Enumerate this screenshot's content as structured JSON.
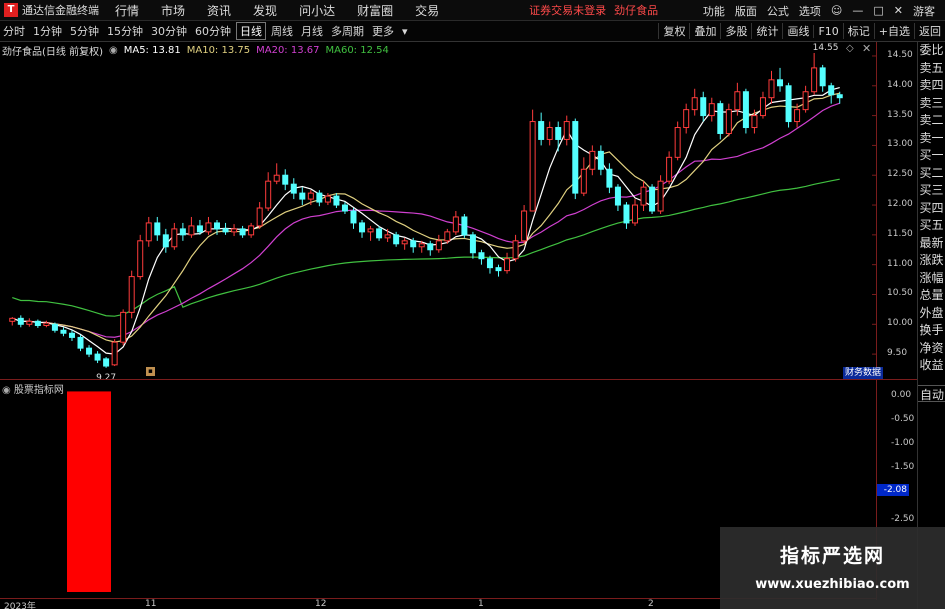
{
  "app": {
    "title": "通达信金融终端",
    "logo": "T"
  },
  "menu": [
    "行情",
    "市场",
    "资讯",
    "发现",
    "问小达",
    "财富圈",
    "交易"
  ],
  "notice": {
    "login": "证券交易未登录",
    "stock": "劲仔食品"
  },
  "top_right": [
    "功能",
    "版面",
    "公式",
    "选项"
  ],
  "guest": "游客",
  "periods": [
    "分时",
    "1分钟",
    "5分钟",
    "15分钟",
    "30分钟",
    "60分钟",
    "日线",
    "周线",
    "月线",
    "多周期",
    "更多"
  ],
  "active_period": "日线",
  "toolbar_right": [
    "复权",
    "叠加",
    "多股",
    "统计",
    "画线",
    "F10",
    "标记",
    "+自选",
    "返回"
  ],
  "legend": {
    "title": "劲仔食品(日线 前复权)",
    "ma5": "MA5: 13.81",
    "ma10": "MA10: 13.75",
    "ma20": "MA20: 13.67",
    "ma60": "MA60: 12.54"
  },
  "annotations": {
    "high": "14.55",
    "low": "9.27"
  },
  "side_panel": [
    "委比",
    "卖五",
    "卖四",
    "卖三",
    "卖二",
    "卖一",
    "买一",
    "买二",
    "买三",
    "买四",
    "买五",
    "最新",
    "涨跌",
    "涨幅",
    "总量",
    "外盘",
    "换手",
    "净资",
    "收益"
  ],
  "side_auto": "自动",
  "cw_flag": "财务数据",
  "subchart": {
    "title": "股票指标网",
    "current_value": "-2.08",
    "ticks": [
      "0.00",
      "-0.50",
      "-1.00",
      "-1.50",
      "-2.00",
      "-2.50"
    ]
  },
  "xaxis": [
    "2023年",
    "11",
    "12",
    "1",
    "2"
  ],
  "watermark": {
    "line1": "指标严选网",
    "line2": "www.xuezhibiao.com"
  },
  "chart_data": [
    {
      "type": "candlestick",
      "title": "劲仔食品(日线 前复权)",
      "ylim": [
        9.2,
        14.6
      ],
      "yticks": [
        9.5,
        10.0,
        10.5,
        11.0,
        11.5,
        12.0,
        12.5,
        13.0,
        13.5,
        14.0,
        14.5
      ],
      "colors": {
        "up": "#ff3c3c",
        "down": "#54ffff",
        "ma5": "#ffffff",
        "ma10": "#e0d080",
        "ma20": "#d040d0",
        "ma60": "#40c040"
      },
      "candles": [
        [
          10.05,
          10.1,
          9.98,
          10.12
        ],
        [
          10.1,
          10.0,
          9.95,
          10.15
        ],
        [
          10.0,
          10.05,
          9.96,
          10.1
        ],
        [
          10.05,
          9.98,
          9.94,
          10.08
        ],
        [
          9.98,
          10.02,
          9.95,
          10.06
        ],
        [
          10.0,
          9.9,
          9.86,
          10.03
        ],
        [
          9.9,
          9.85,
          9.8,
          9.95
        ],
        [
          9.85,
          9.78,
          9.72,
          9.9
        ],
        [
          9.78,
          9.6,
          9.55,
          9.82
        ],
        [
          9.6,
          9.5,
          9.45,
          9.65
        ],
        [
          9.5,
          9.4,
          9.35,
          9.55
        ],
        [
          9.42,
          9.3,
          9.27,
          9.45
        ],
        [
          9.32,
          9.7,
          9.3,
          9.75
        ],
        [
          9.7,
          10.2,
          9.65,
          10.25
        ],
        [
          10.2,
          10.8,
          10.1,
          10.9
        ],
        [
          10.8,
          11.4,
          10.75,
          11.5
        ],
        [
          11.4,
          11.7,
          11.3,
          11.8
        ],
        [
          11.7,
          11.5,
          11.4,
          11.8
        ],
        [
          11.5,
          11.3,
          11.2,
          11.6
        ],
        [
          11.3,
          11.6,
          11.25,
          11.7
        ],
        [
          11.6,
          11.5,
          11.4,
          11.7
        ],
        [
          11.5,
          11.65,
          11.45,
          11.8
        ],
        [
          11.65,
          11.55,
          11.5,
          11.75
        ],
        [
          11.55,
          11.7,
          11.5,
          11.8
        ],
        [
          11.7,
          11.6,
          11.5,
          11.75
        ],
        [
          11.6,
          11.55,
          11.5,
          11.7
        ],
        [
          11.55,
          11.6,
          11.48,
          11.68
        ],
        [
          11.6,
          11.5,
          11.45,
          11.65
        ],
        [
          11.5,
          11.65,
          11.45,
          11.7
        ],
        [
          11.65,
          11.95,
          11.6,
          12.05
        ],
        [
          11.95,
          12.4,
          11.9,
          12.55
        ],
        [
          12.4,
          12.5,
          12.35,
          12.7
        ],
        [
          12.5,
          12.35,
          12.25,
          12.6
        ],
        [
          12.35,
          12.2,
          12.1,
          12.45
        ],
        [
          12.2,
          12.1,
          12.0,
          12.3
        ],
        [
          12.1,
          12.2,
          12.0,
          12.25
        ],
        [
          12.2,
          12.05,
          11.98,
          12.25
        ],
        [
          12.05,
          12.15,
          12.0,
          12.2
        ],
        [
          12.15,
          12.0,
          11.95,
          12.2
        ],
        [
          12.0,
          11.9,
          11.85,
          12.05
        ],
        [
          11.9,
          11.7,
          11.6,
          11.95
        ],
        [
          11.7,
          11.55,
          11.45,
          11.75
        ],
        [
          11.55,
          11.6,
          11.4,
          11.65
        ],
        [
          11.6,
          11.45,
          11.4,
          11.65
        ],
        [
          11.45,
          11.5,
          11.38,
          11.6
        ],
        [
          11.5,
          11.35,
          11.3,
          11.55
        ],
        [
          11.35,
          11.4,
          11.25,
          11.45
        ],
        [
          11.4,
          11.3,
          11.2,
          11.45
        ],
        [
          11.3,
          11.35,
          11.2,
          11.4
        ],
        [
          11.35,
          11.25,
          11.15,
          11.4
        ],
        [
          11.25,
          11.4,
          11.2,
          11.5
        ],
        [
          11.4,
          11.55,
          11.35,
          11.6
        ],
        [
          11.55,
          11.8,
          11.5,
          11.9
        ],
        [
          11.8,
          11.5,
          11.45,
          11.85
        ],
        [
          11.5,
          11.2,
          11.1,
          11.55
        ],
        [
          11.2,
          11.1,
          11.0,
          11.25
        ],
        [
          11.1,
          10.95,
          10.85,
          11.15
        ],
        [
          10.95,
          10.9,
          10.8,
          11.0
        ],
        [
          10.9,
          11.1,
          10.85,
          11.2
        ],
        [
          11.1,
          11.4,
          11.05,
          11.5
        ],
        [
          11.4,
          11.9,
          11.35,
          12.0
        ],
        [
          11.9,
          13.4,
          11.9,
          13.6
        ],
        [
          13.4,
          13.1,
          13.0,
          13.55
        ],
        [
          13.1,
          13.3,
          13.0,
          13.4
        ],
        [
          13.3,
          13.1,
          12.9,
          13.4
        ],
        [
          13.1,
          13.4,
          13.0,
          13.5
        ],
        [
          13.4,
          12.2,
          12.1,
          13.45
        ],
        [
          12.2,
          12.6,
          12.15,
          12.8
        ],
        [
          12.6,
          12.9,
          12.5,
          13.0
        ],
        [
          12.9,
          12.6,
          12.5,
          13.0
        ],
        [
          12.6,
          12.3,
          12.2,
          12.7
        ],
        [
          12.3,
          12.0,
          11.9,
          12.35
        ],
        [
          12.0,
          11.7,
          11.6,
          12.05
        ],
        [
          11.7,
          12.0,
          11.65,
          12.1
        ],
        [
          12.0,
          12.3,
          11.9,
          12.4
        ],
        [
          12.3,
          11.9,
          11.85,
          12.35
        ],
        [
          11.9,
          12.4,
          11.85,
          12.5
        ],
        [
          12.4,
          12.8,
          12.35,
          12.9
        ],
        [
          12.8,
          13.3,
          12.75,
          13.4
        ],
        [
          13.3,
          13.6,
          13.2,
          13.7
        ],
        [
          13.6,
          13.8,
          13.5,
          13.95
        ],
        [
          13.8,
          13.5,
          13.4,
          13.9
        ],
        [
          13.5,
          13.7,
          13.4,
          13.8
        ],
        [
          13.7,
          13.2,
          13.1,
          13.75
        ],
        [
          13.2,
          13.6,
          13.15,
          13.7
        ],
        [
          13.6,
          13.9,
          13.5,
          14.05
        ],
        [
          13.9,
          13.3,
          13.2,
          13.95
        ],
        [
          13.3,
          13.5,
          13.2,
          13.6
        ],
        [
          13.5,
          13.8,
          13.45,
          13.9
        ],
        [
          13.8,
          14.1,
          13.7,
          14.25
        ],
        [
          14.1,
          14.0,
          13.9,
          14.3
        ],
        [
          14.0,
          13.4,
          13.3,
          14.05
        ],
        [
          13.4,
          13.6,
          13.3,
          13.7
        ],
        [
          13.6,
          13.9,
          13.55,
          14.0
        ],
        [
          13.9,
          14.3,
          13.85,
          14.55
        ],
        [
          14.3,
          14.0,
          13.9,
          14.35
        ],
        [
          14.0,
          13.85,
          13.7,
          14.05
        ],
        [
          13.85,
          13.8,
          13.7,
          13.9
        ]
      ]
    },
    {
      "type": "bar",
      "title": "股票指标网",
      "ylim": [
        -2.7,
        0.1
      ],
      "series": [
        {
          "values": [
            -2.7
          ]
        }
      ],
      "color": "#ff0000"
    }
  ]
}
